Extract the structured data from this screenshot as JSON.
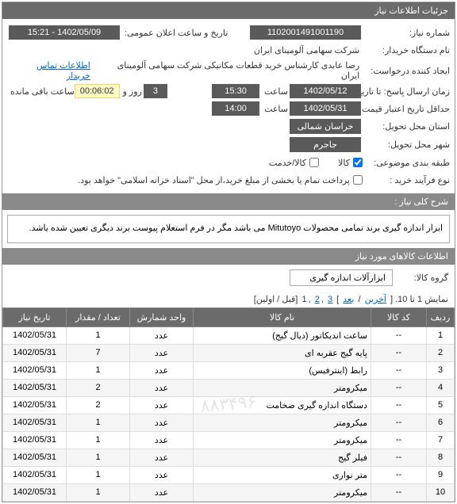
{
  "panel_title": "جزئیات اطلاعات نیاز",
  "labels": {
    "req_no": "شماره نیاز:",
    "pub_date": "تاریخ و ساعت اعلان عمومی:",
    "buyer": "نام دستگاه خریدار:",
    "creator": "ایجاد کننده درخواست:",
    "deadline": "زمان ارسال پاسخ: تا تاریخ:",
    "time": "ساعت",
    "day_and": "روز و",
    "remaining": "ساعت باقی مانده",
    "validity": "حداقل تاریخ اعتبار قیمت: تا تاریخ:",
    "province": "استان محل تحویل:",
    "city": "شهر محل تحویل:",
    "category": "طبقه بندی موضوعی:",
    "goods": "کالا",
    "service": "کالا/خدمت",
    "purchase_type": "نوع فرآیند خرید :",
    "payment_note": "پرداخت تمام یا بخشی از مبلغ خرید،از محل \"اسناد خزانه اسلامی\" خواهد بود.",
    "desc_header": "شرح کلی نیاز :",
    "items_header": "اطلاعات کالاهای مورد نیاز",
    "group": "گروه کالا:",
    "contact_link": "اطلاعات تماس خریدار"
  },
  "values": {
    "req_no": "1102001491001190",
    "pub_date": "1402/05/09 - 15:21",
    "buyer": "شرکت سهامی آلومینای ایران",
    "creator": "رضا عابدی کارشناس خرید قطعات مکانیکی شرکت سهامی آلومینای ایران",
    "deadline_date": "1402/05/12",
    "deadline_time": "15:30",
    "days_left": "3",
    "countdown": "00:06:02",
    "validity_date": "1402/05/31",
    "validity_time": "14:00",
    "province": "خراسان شمالی",
    "city": "جاجرم",
    "description": "ابزار اندازه گیری برند تمامی محصولات Mitutoyo می باشد مگر در فرم استعلام پیوست برند دیگری تعیین شده باشد.",
    "group": "ابزارآلات اندازه گیری"
  },
  "pager": {
    "text_prefix": "نمایش 1 تا 10. [ ",
    "last": "آخرین",
    "sep1": " / ",
    "next": "بعد",
    "sep2": " ] ",
    "p3": "3",
    "p2": "2",
    "p1": "1",
    "suffix": " [قبل / اولین]"
  },
  "table": {
    "headers": {
      "idx": "ردیف",
      "code": "کد کالا",
      "name": "نام کالا",
      "unit": "واحد شمارش",
      "qty": "تعداد / مقدار",
      "date": "تاریخ نیاز"
    },
    "rows": [
      {
        "idx": "1",
        "code": "--",
        "name": "ساعت اندیکاتور (دیال گیج)",
        "unit": "عدد",
        "qty": "1",
        "date": "1402/05/31"
      },
      {
        "idx": "2",
        "code": "--",
        "name": "پایه گیج عقربه ای",
        "unit": "عدد",
        "qty": "7",
        "date": "1402/05/31"
      },
      {
        "idx": "3",
        "code": "--",
        "name": "رابط (اینترفیس)",
        "unit": "عدد",
        "qty": "1",
        "date": "1402/05/31"
      },
      {
        "idx": "4",
        "code": "--",
        "name": "میکرومتر",
        "unit": "عدد",
        "qty": "2",
        "date": "1402/05/31"
      },
      {
        "idx": "5",
        "code": "--",
        "name": "دستگاه اندازه گیری ضخامت",
        "unit": "عدد",
        "qty": "2",
        "date": "1402/05/31"
      },
      {
        "idx": "6",
        "code": "--",
        "name": "میکرومتر",
        "unit": "عدد",
        "qty": "1",
        "date": "1402/05/31"
      },
      {
        "idx": "7",
        "code": "--",
        "name": "میکرومتر",
        "unit": "عدد",
        "qty": "1",
        "date": "1402/05/31"
      },
      {
        "idx": "8",
        "code": "--",
        "name": "فیلر گیج",
        "unit": "عدد",
        "qty": "1",
        "date": "1402/05/31"
      },
      {
        "idx": "9",
        "code": "--",
        "name": "متر نواری",
        "unit": "عدد",
        "qty": "1",
        "date": "1402/05/31"
      },
      {
        "idx": "10",
        "code": "--",
        "name": "میکرومتر",
        "unit": "عدد",
        "qty": "1",
        "date": "1402/05/31"
      }
    ]
  },
  "watermark": "۸۸۳۴۹۶"
}
